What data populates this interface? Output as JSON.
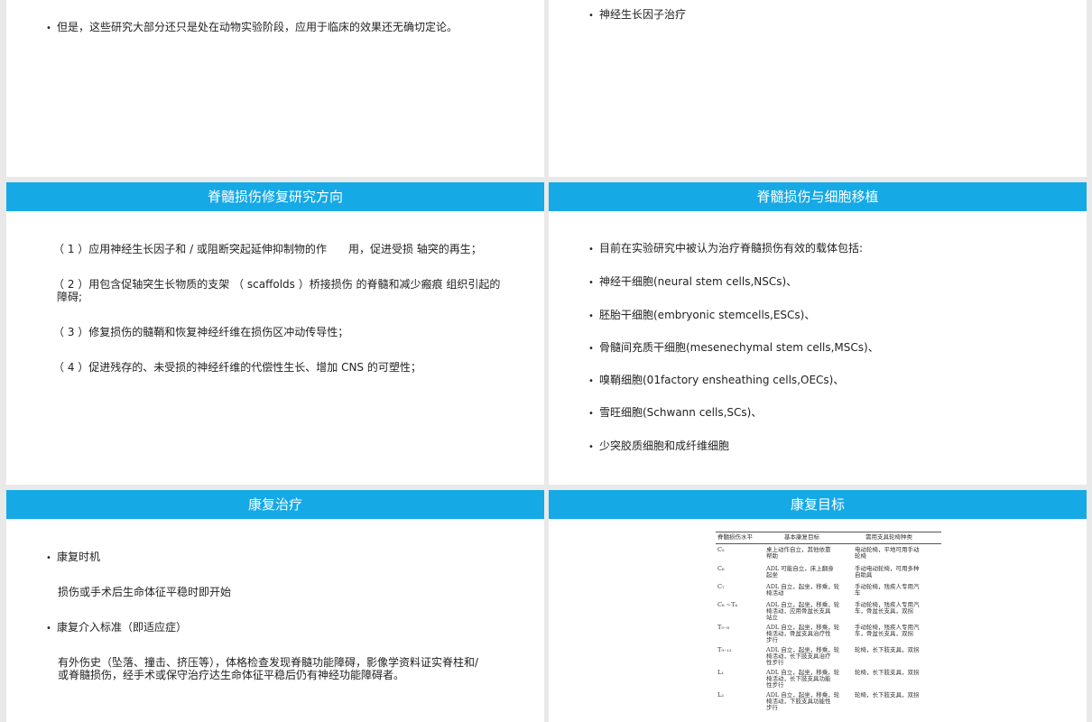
{
  "slides": {
    "top_left": {
      "bullets": [
        "但是，这些研究大部分还只是处在动物实验阶段，应用于临床的效果还无确切定论。"
      ]
    },
    "top_right": {
      "bullets": [
        "神经生长因子治疗"
      ]
    },
    "repair_direction": {
      "title": "脊髓损伤修复研究方向",
      "items": [
        "（ 1 ）应用神经生长因子和 / 或阻断突起延伸抑制物的作　　用，促进受损 轴突的再生；",
        "（ 2 ）用包含促轴突生长物质的支架 （ scaffolds ）桥接损伤 的脊髓和减少瘢痕 组织引起的",
        "障碍;",
        "（ 3 ）修复损伤的髓鞘和恢复神经纤维在损伤区冲动传导性；",
        "（ 4 ）促进残存的、未受损的神经纤维的代偿性生长、增加 CNS 的可塑性；"
      ]
    },
    "cell_transplant": {
      "title": "脊髓损伤与细胞移植",
      "bullets": [
        "目前在实验研究中被认为治疗脊髓损伤有效的载体包括:",
        "神经干细胞(neural stem cells,NSCs)、",
        "胚胎干细胞(embryonic stemcells,ESCs)、",
        "骨髓间充质干细胞(mesenechymal stem cells,MSCs)、",
        "嗅鞘细胞(01factory ensheathing cells,OECs)、",
        "雪旺细胞(Schwann cells,SCs)、",
        "少突胶质细胞和成纤维细胞"
      ]
    },
    "rehab_therapy": {
      "title": "康复治疗",
      "b1": "康复时机",
      "t1": "损伤或手术后生命体征平稳时即开始",
      "b2": "康复介入标准（即适应症）",
      "t2a": "有外伤史（坠落、撞击、挤压等），体格检查发现脊髓功能障碍，影像学资料证实脊柱和/",
      "t2b": "或脊髓损伤，经手术或保守治疗达生命体征平稳后仍有神经功能障碍者。"
    },
    "rehab_goal": {
      "title": "康复目标",
      "table": {
        "headers": [
          "脊髓损伤水平",
          "基本康复目标",
          "需用支具轮椅种类"
        ],
        "rows": [
          {
            "level": "C₅",
            "goal": [
              "桌上动作自立，其他依靠",
              "帮助"
            ],
            "aid": [
              "电动轮椅，平地可用手动",
              "轮椅"
            ]
          },
          {
            "level": "C₆",
            "goal": [
              "ADL 可能自立，床上翻身",
              "起坐"
            ],
            "aid": [
              "手动电动轮椅，可用多种",
              "自助具"
            ]
          },
          {
            "level": "C₇",
            "goal": [
              "ADL 自立，起坐，移乘，轮",
              "椅活动"
            ],
            "aid": [
              "手动轮椅，残疾人专用汽",
              "车"
            ]
          },
          {
            "level": "C₈ ~T₄",
            "goal": [
              "ADL 自立，起坐，移乘，轮",
              "椅活动，应用骨盆长支具",
              "站立"
            ],
            "aid": [
              "手动轮椅，残疾人专用汽",
              "车，骨盆长支具，双拐"
            ]
          },
          {
            "level": "T₅₋₈",
            "goal": [
              "ADL 自立，起坐，移乘，轮",
              "椅活动，骨盆支具治疗性",
              "步行"
            ],
            "aid": [
              "手动轮椅，残疾人专用汽",
              "车，骨盆长支具，双拐"
            ]
          },
          {
            "level": "T₉₋₁₂",
            "goal": [
              "ADL 自立，起坐，移乘，轮",
              "椅活动，长下肢支具治疗",
              "性步行"
            ],
            "aid": [
              "轮椅，长下肢支具，双拐"
            ]
          },
          {
            "level": "L₁",
            "goal": [
              "ADL 自立，起坐，移乘，轮",
              "椅活动，长下肢支具功能",
              "性步行"
            ],
            "aid": [
              "轮椅，长下肢支具，双拐"
            ]
          },
          {
            "level": "L₂",
            "goal": [
              "ADL 自立，起坐，移乘，轮",
              "椅活动，下肢支具功能性",
              "步行"
            ],
            "aid": [
              "轮椅，长下肢支具，双拐"
            ]
          }
        ]
      }
    }
  },
  "colors": {
    "header_bg": "#15a9e6",
    "header_text": "#ffffff",
    "page_bg": "#e9e9e9"
  }
}
